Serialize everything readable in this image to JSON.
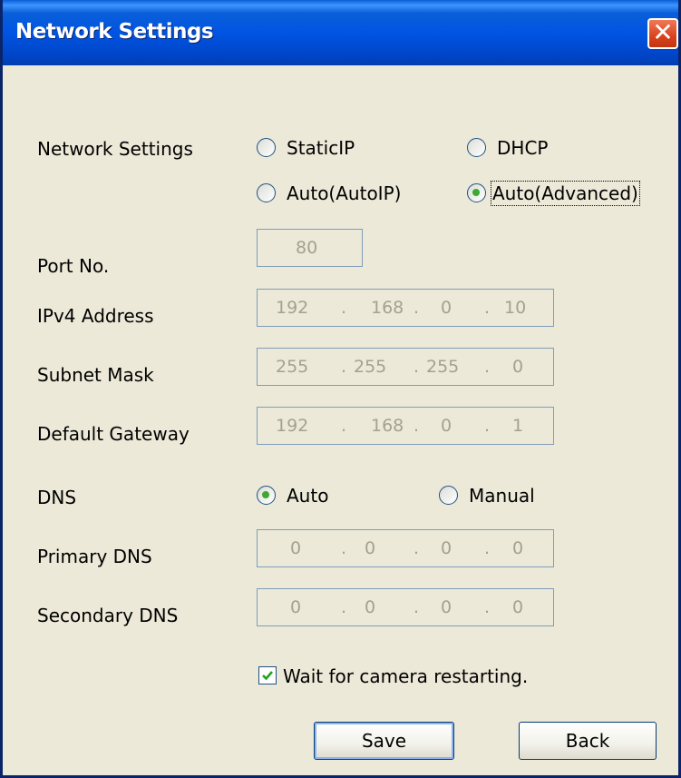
{
  "window": {
    "title": "Network Settings",
    "close_glyph": "✕"
  },
  "network_settings": {
    "label": "Network Settings",
    "options": [
      {
        "label": "StaticIP",
        "selected": false
      },
      {
        "label": "DHCP",
        "selected": false
      },
      {
        "label": "Auto(AutoIP)",
        "selected": false
      },
      {
        "label": "Auto(Advanced)",
        "selected": true
      }
    ]
  },
  "port": {
    "label": "Port No.",
    "value": "80"
  },
  "ipv4": {
    "label": "IPv4 Address",
    "octets": [
      "192",
      "168",
      "0",
      "10"
    ],
    "separator": "."
  },
  "subnet": {
    "label": "Subnet Mask",
    "octets": [
      "255",
      "255",
      "255",
      "0"
    ],
    "separator": "."
  },
  "gateway": {
    "label": "Default Gateway",
    "octets": [
      "192",
      "168",
      "0",
      "1"
    ],
    "separator": "."
  },
  "dns": {
    "label": "DNS",
    "options": [
      {
        "label": "Auto",
        "selected": true
      },
      {
        "label": "Manual",
        "selected": false
      }
    ]
  },
  "primary_dns": {
    "label": "Primary DNS",
    "octets": [
      "0",
      "0",
      "0",
      "0"
    ],
    "separator": "."
  },
  "secondary_dns": {
    "label": "Secondary DNS",
    "octets": [
      "0",
      "0",
      "0",
      "0"
    ],
    "separator": "."
  },
  "wait_checkbox": {
    "label": "Wait for camera restarting.",
    "checked": true
  },
  "buttons": {
    "save": "Save",
    "back": "Back"
  }
}
